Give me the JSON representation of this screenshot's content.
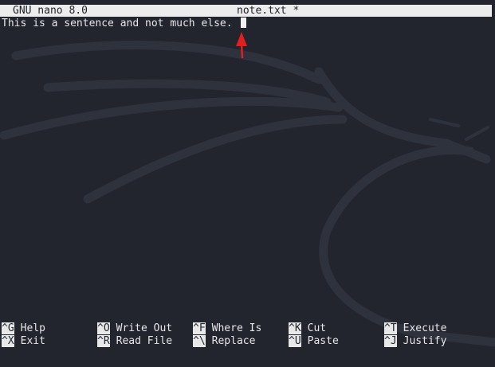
{
  "title_bar": {
    "app": "GNU nano 8.0",
    "file": "note.txt *"
  },
  "editor": {
    "lines": [
      "This is a sentence and not much else."
    ]
  },
  "annotation": {
    "color": "#e01f1f",
    "icon": "red-arrow-icon"
  },
  "shortcuts": [
    {
      "key": "^G",
      "label": "Help"
    },
    {
      "key": "^O",
      "label": "Write Out"
    },
    {
      "key": "^F",
      "label": "Where Is"
    },
    {
      "key": "^K",
      "label": "Cut"
    },
    {
      "key": "^T",
      "label": "Execute"
    },
    {
      "key": "^X",
      "label": "Exit"
    },
    {
      "key": "^R",
      "label": "Read File"
    },
    {
      "key": "^\\",
      "label": "Replace"
    },
    {
      "key": "^U",
      "label": "Paste"
    },
    {
      "key": "^J",
      "label": "Justify"
    }
  ],
  "colors": {
    "background": "#22252e",
    "title_bar": "#ececec",
    "text": "#e6e6e6",
    "cursor": "#f0f0f0"
  }
}
